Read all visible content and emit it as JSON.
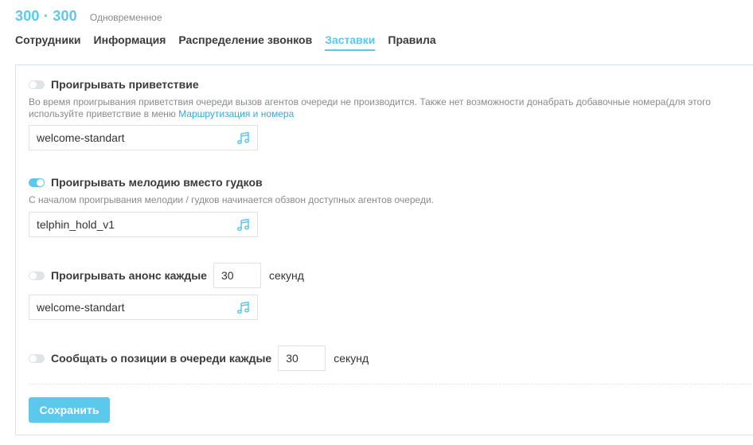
{
  "header": {
    "title": "300 · 300",
    "subtitle": "Одновременное"
  },
  "tabs": [
    {
      "label": "Сотрудники",
      "active": false
    },
    {
      "label": "Информация",
      "active": false
    },
    {
      "label": "Распределение звонков",
      "active": false
    },
    {
      "label": "Заставки",
      "active": true
    },
    {
      "label": "Правила",
      "active": false
    }
  ],
  "greeting": {
    "enabled": false,
    "label": "Проигрывать приветствие",
    "desc_text": "Во время проигрывания приветствия очереди вызов агентов очереди не производится. Также нет возможности донабрать добавочные номера(для этого используйте приветствие в меню ",
    "desc_link": "Маршрутизация и номера",
    "sound": "welcome-standart",
    "icon": "music-note-icon"
  },
  "hold_melody": {
    "enabled": true,
    "label": "Проигрывать мелодию вместо гудков",
    "desc": "С началом проигрывания мелодии / гудков начинается обзвон доступных агентов очереди.",
    "sound": "telphin_hold_v1",
    "icon": "music-note-icon"
  },
  "announce": {
    "enabled": false,
    "label": "Проигрывать анонс каждые",
    "interval": "30",
    "unit": "секунд",
    "sound": "welcome-standart",
    "icon": "music-note-icon"
  },
  "position": {
    "enabled": false,
    "label": "Сообщать о позиции в очереди каждые",
    "interval": "30",
    "unit": "секунд"
  },
  "save_label": "Сохранить",
  "colors": {
    "accent": "#5bc8ec",
    "link": "#3aa8d8",
    "toggle_off": "#e1e4e6"
  }
}
